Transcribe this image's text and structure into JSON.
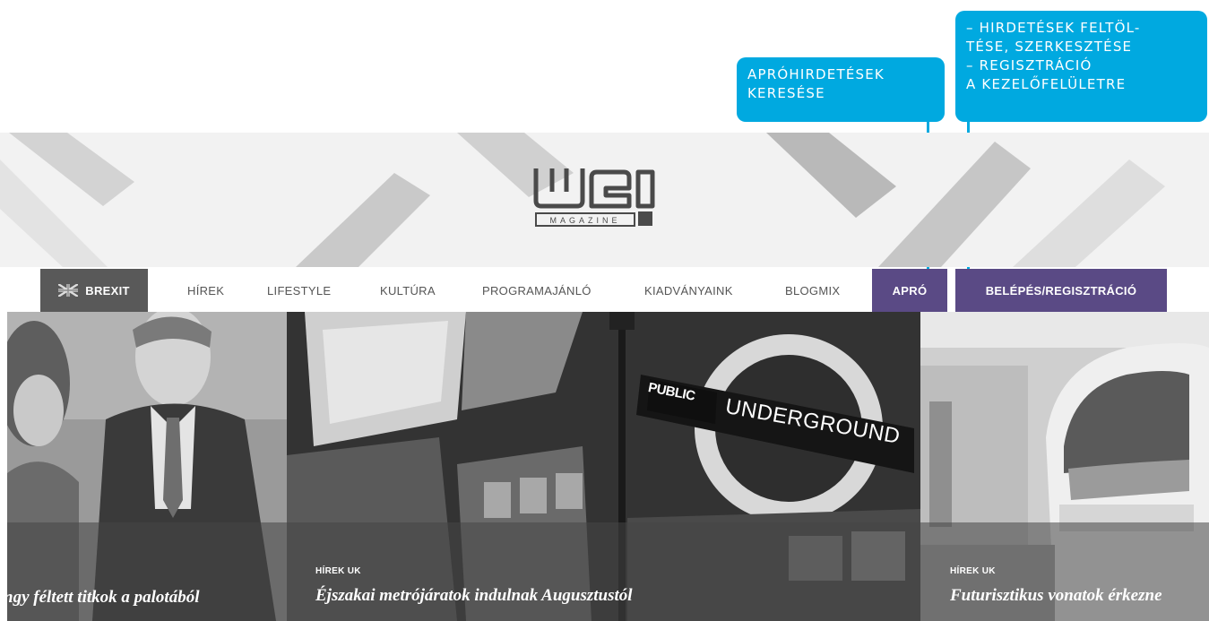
{
  "callouts": {
    "search": "APRÓHIRDETÉSEK\nKERESÉSE",
    "upload": "– HIRDETÉSEK FELTÖL-\nTÉSE, SZERKESZTÉSE\n– REGISZTRÁCIÓ\nA KEZELŐFELÜLETRE"
  },
  "logo": {
    "wordmark": "wei",
    "tagline": "MAGAZINE"
  },
  "nav": {
    "brexit": "BREXIT",
    "hirek": "HÍREK",
    "lifestyle": "LIFESTYLE",
    "kultura": "KULTÚRA",
    "programajanlo": "PROGRAMAJÁNLÓ",
    "kiadvanyaink": "KIADVÁNYAINK",
    "blogmix": "BLOGMIX",
    "apro": "APRÓ",
    "belepes": "BELÉPÉS/REGISZTRÁCIÓ"
  },
  "slides": [
    {
      "category": "",
      "headline": "ngy féltett titkok a palotából"
    },
    {
      "category": "HÍREK UK",
      "headline": "Éjszakai metrójáratok indulnak Augusztustól"
    },
    {
      "category": "HÍREK UK",
      "headline": "Futurisztikus vonatok érkezne"
    }
  ],
  "signs": {
    "public": "PUBLIC",
    "underground": "UNDERGROUND"
  },
  "colors": {
    "callout": "#00a9e0",
    "nav_accent": "#5a4a85",
    "brexit_bg": "#595959"
  }
}
